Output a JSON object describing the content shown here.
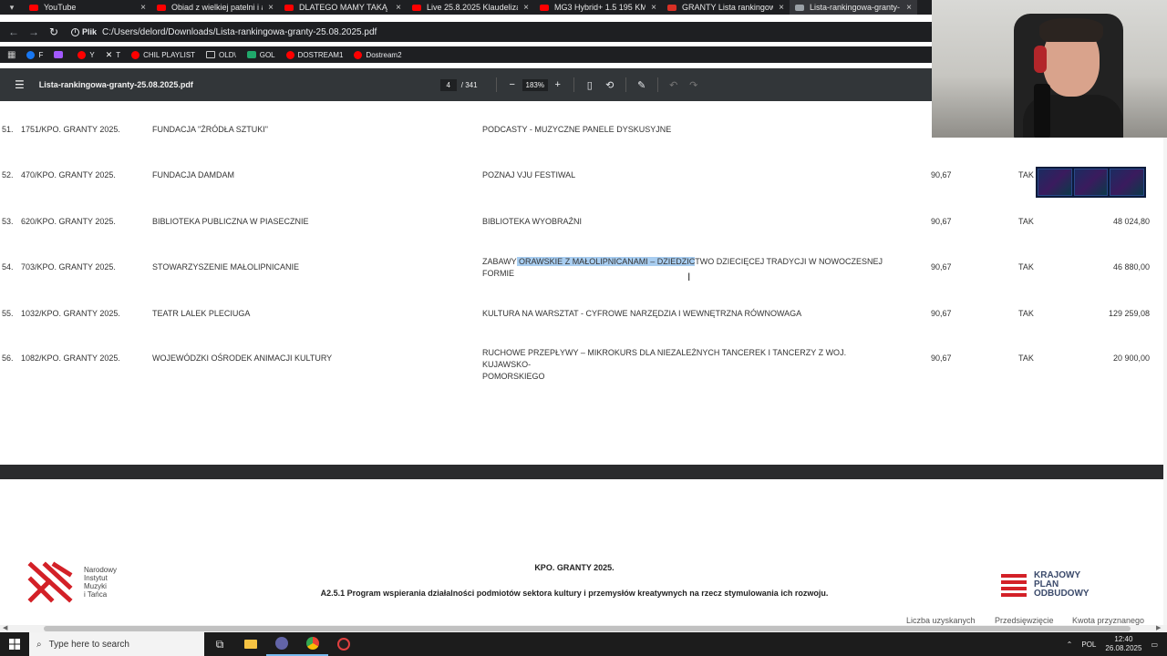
{
  "browser": {
    "tabs": [
      {
        "title": "YouTube",
        "favicon_color": "#ff0000",
        "active": false
      },
      {
        "title": "Obiad z wielkiej patelni i a",
        "favicon_color": "#ff0000",
        "active": false
      },
      {
        "title": "DLATEGO MAMY TAKĄ D",
        "favicon_color": "#ff0000",
        "active": false
      },
      {
        "title": "Live 25.8.2025 Klaudeliza",
        "favicon_color": "#ff0000",
        "active": false
      },
      {
        "title": "MG3 Hybrid+ 1.5 195 KM",
        "favicon_color": "#ff0000",
        "active": false
      },
      {
        "title": "GRANTY Lista rankingowa",
        "favicon_color": "#d93025",
        "active": false
      },
      {
        "title": "Lista-rankingowa-granty-",
        "favicon_color": "#9aa0a6",
        "active": true
      }
    ],
    "address": {
      "chip": "Plik",
      "url": "C:/Users/delord/Downloads/Lista-rankingowa-granty-25.08.2025.pdf"
    },
    "bookmarks": [
      {
        "label": "F",
        "color": "#1877f2",
        "kind": "round"
      },
      {
        "label": "",
        "color": "#a259ff",
        "kind": "square"
      },
      {
        "label": "Y",
        "color": "#ff0000",
        "kind": "round"
      },
      {
        "label": "T",
        "color": "",
        "kind": "x"
      },
      {
        "label": "CHIL PLAYLIST",
        "color": "#ff0000",
        "kind": "round"
      },
      {
        "label": "OLD\\",
        "color": "",
        "kind": "folder"
      },
      {
        "label": "GOL",
        "color": "#20a86b",
        "kind": "square"
      },
      {
        "label": "DOSTREAM1",
        "color": "#ff0000",
        "kind": "round"
      },
      {
        "label": "Dostream2",
        "color": "#ff0000",
        "kind": "round"
      }
    ]
  },
  "pdf": {
    "filename": "Lista-rankingowa-granty-25.08.2025.pdf",
    "page_current": "4",
    "page_total": "/ 341",
    "zoom": "183%",
    "rows": [
      {
        "no": "51.",
        "code": "1751/KPO. GRANTY 2025.",
        "org": "FUNDACJA \"ŹRÓDŁA SZTUKI\"",
        "proj": "PODCASTY  - MUZYCZNE PANELE DYSKUSYJNE",
        "proj2": "",
        "score": "",
        "ok": "",
        "amount": ""
      },
      {
        "no": "52.",
        "code": "470/KPO. GRANTY 2025.",
        "org": "FUNDACJA DAMDAM",
        "proj": "POZNAJ VJU FESTIWAL",
        "proj2": "",
        "score": "90,67",
        "ok": "TAK",
        "amount": ""
      },
      {
        "no": "53.",
        "code": "620/KPO. GRANTY 2025.",
        "org": "BIBLIOTEKA PUBLICZNA W PIASECZNIE",
        "proj": "BIBLIOTEKA WYOBRAŹNI",
        "proj2": "",
        "score": "90,67",
        "ok": "TAK",
        "amount": "48 024,80"
      },
      {
        "no": "54.",
        "code": "703/KPO. GRANTY 2025.",
        "org": "STOWARZYSZENIE MAŁOLIPNICANIE",
        "proj_pre": "ZABAWY",
        "proj_hl": " ORAWSKIE Z MAŁOLIPNICANAMI – DZIEDZIC",
        "proj_post": "TWO DZIECIĘCEJ TRADYCJI W NOWOCZESNEJ",
        "proj2": "FORMIE",
        "score": "90,67",
        "ok": "TAK",
        "amount": "46 880,00"
      },
      {
        "no": "55.",
        "code": "1032/KPO. GRANTY 2025.",
        "org": "TEATR LALEK PLECIUGA",
        "proj": "KULTURA NA WARSZTAT - CYFROWE NARZĘDZIA I WEWNĘTRZNA RÓWNOWAGA",
        "proj2": "",
        "score": "90,67",
        "ok": "TAK",
        "amount": "129 259,08"
      },
      {
        "no": "56.",
        "code": "1082/KPO. GRANTY 2025.",
        "org": "WOJEWÓDZKI OŚRODEK ANIMACJI KULTURY",
        "proj": "RUCHOWE PRZEPŁYWY – MIKROKURS DLA NIEZALEŻNYCH TANCEREK I TANCERZY Z WOJ. KUJAWSKO-",
        "proj2": "POMORSKIEGO",
        "score": "90,67",
        "ok": "TAK",
        "amount": "20 900,00"
      }
    ],
    "page2": {
      "nimit_lines": [
        "Narodowy",
        "Instytut",
        "Muzyki",
        "i Tańca"
      ],
      "title": "KPO. GRANTY 2025.",
      "program": "A2.5.1 Program wspierania działalności podmiotów sektora kultury i przemysłów kreatywnych na rzecz stymulowania ich rozwoju.",
      "kpo_lines": [
        "KRAJOWY",
        "PLAN",
        "ODBUDOWY"
      ],
      "col_heads": [
        "Liczba uzyskanych",
        "Przedsięwzięcie",
        "Kwota przyznanego"
      ]
    }
  },
  "taskbar": {
    "search_placeholder": "Type here to search",
    "lang": "POL",
    "time": "12:40",
    "date": "26.08.2025"
  },
  "colors": {
    "toolbar": "#323639",
    "chrome": "#1e1f22",
    "selection": "#a8cdf0"
  }
}
